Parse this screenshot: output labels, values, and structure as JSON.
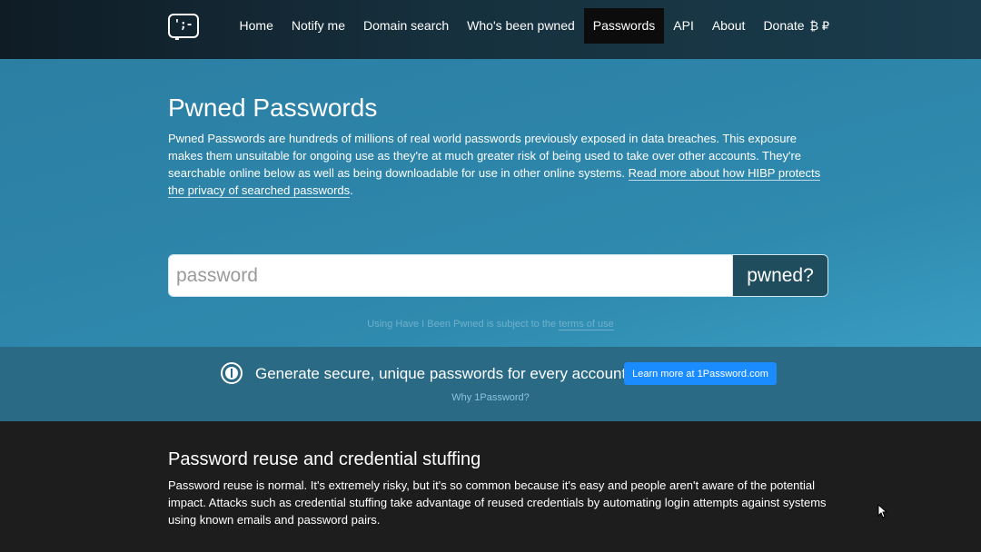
{
  "logo": {
    "text": "';--"
  },
  "nav": {
    "items": [
      {
        "label": "Home",
        "active": false
      },
      {
        "label": "Notify me",
        "active": false
      },
      {
        "label": "Domain search",
        "active": false
      },
      {
        "label": "Who's been pwned",
        "active": false
      },
      {
        "label": "Passwords",
        "active": true
      },
      {
        "label": "API",
        "active": false
      },
      {
        "label": "About",
        "active": false
      }
    ],
    "donate_label": "Donate",
    "donate_icons": "₿ ₽"
  },
  "hero": {
    "title": "Pwned Passwords",
    "description": "Pwned Passwords are hundreds of millions of real world passwords previously exposed in data breaches. This exposure makes them unsuitable for ongoing use as they're at much greater risk of being used to take over other accounts. They're searchable online below as well as being downloadable for use in other online systems. ",
    "link_text": "Read more about how HIBP protects the privacy of searched passwords",
    "after_link": ".",
    "search_placeholder": "password",
    "search_button": "pwned?",
    "terms_prefix": "Using Have I Been Pwned is subject to the ",
    "terms_link": "terms of use"
  },
  "promo": {
    "text": "Generate secure, unique passwords for every account",
    "button": "Learn more at 1Password.com",
    "sub": "Why 1Password?"
  },
  "content": {
    "title": "Password reuse and credential stuffing",
    "text": "Password reuse is normal. It's extremely risky, but it's so common because it's easy and people aren't aware of the potential impact. Attacks such as credential stuffing take advantage of reused credentials by automating login attempts against systems using known emails and password pairs."
  },
  "colors": {
    "hero_bg": "#2d84a9",
    "promo_bg": "#2a6a85",
    "search_button_bg": "#1f4d5e",
    "promo_button_bg": "#1a8cff",
    "page_bg": "#1d1d1d"
  }
}
